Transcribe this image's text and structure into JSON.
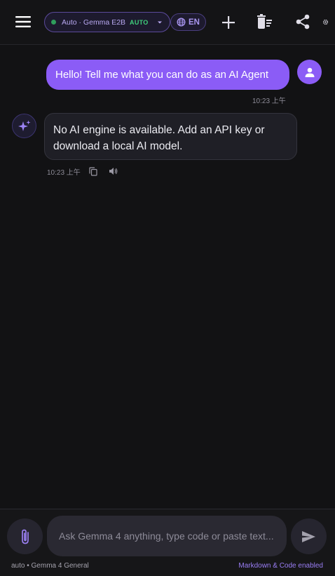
{
  "header": {
    "model_pill": {
      "label": "Auto · Gemma E2B",
      "badge": "AUTO",
      "status_color": "#2f9e5c"
    },
    "language": "EN",
    "icons": [
      "menu-icon",
      "chevron-down-icon",
      "globe-icon",
      "plus-icon",
      "clear-chat-icon",
      "share-icon",
      "gear-icon"
    ]
  },
  "messages": [
    {
      "role": "user",
      "text": "Hello! Tell me what you can do as an AI Agent",
      "time": "10:23 上午"
    },
    {
      "role": "assistant",
      "text": "No AI engine is available. Add an API key or download a local AI model.",
      "time": "10:23 上午"
    }
  ],
  "composer": {
    "placeholder": "Ask Gemma 4 anything, type code or paste text...",
    "value": "",
    "footer_left": "auto • Gemma 4 General",
    "footer_right": "Markdown & Code enabled"
  },
  "colors": {
    "accent": "#8b5cf6",
    "background": "#121214",
    "assistant_bubble": "#1f1f26"
  }
}
